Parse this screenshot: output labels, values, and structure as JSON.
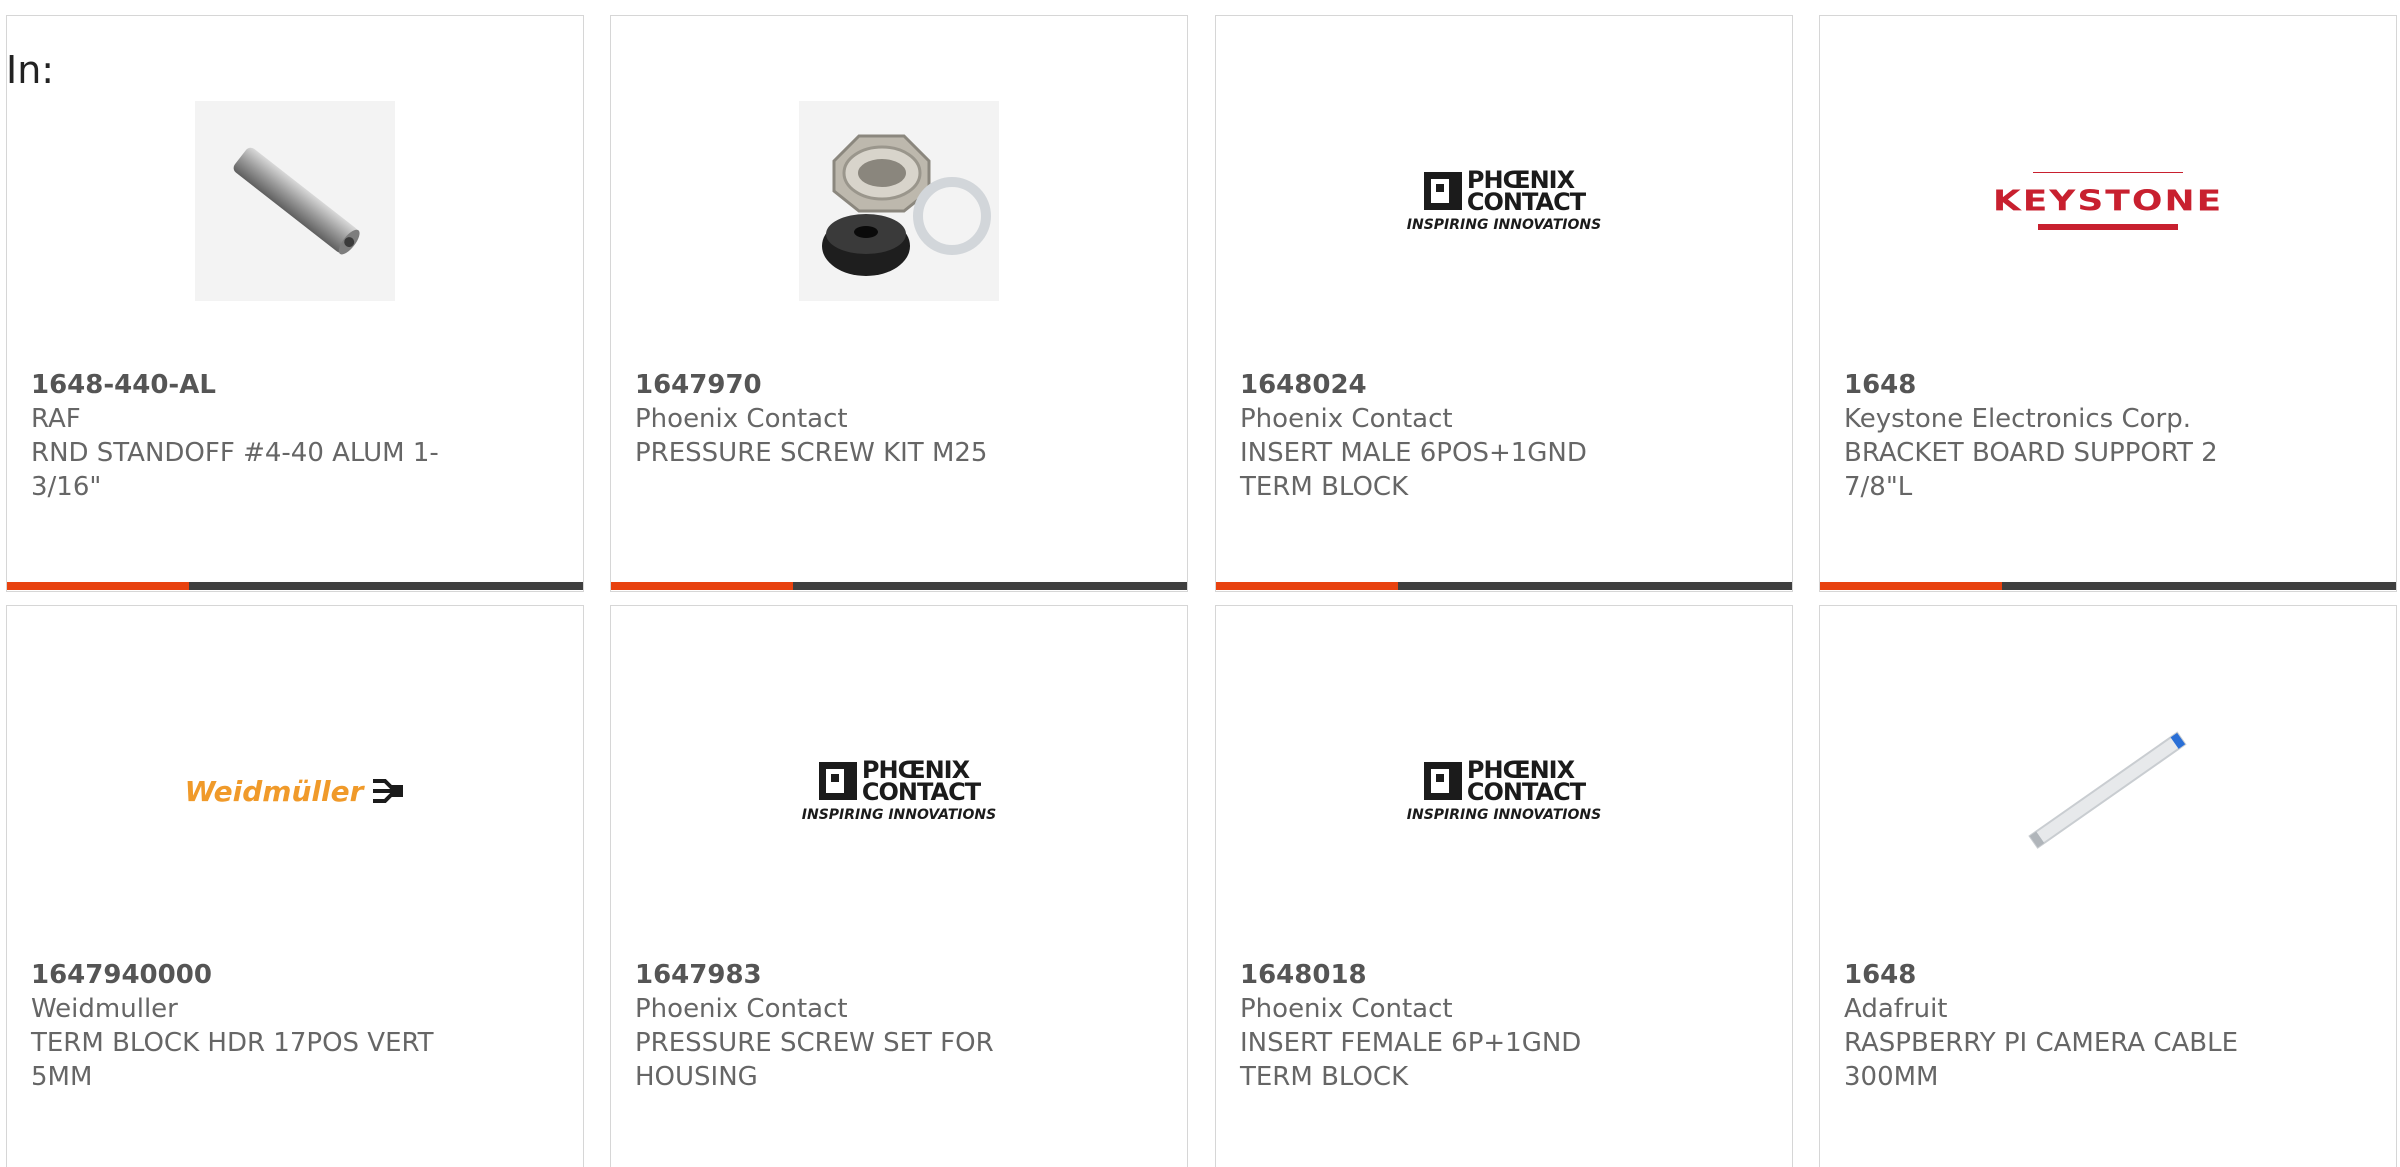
{
  "header": {
    "in_label": "In:"
  },
  "cards": [
    {
      "part_number": "1648-440-AL",
      "manufacturer": "RAF",
      "description": "RND STANDOFF #4-40 ALUM 1-3/16\"",
      "image": "standoff-photo"
    },
    {
      "part_number": "1647970",
      "manufacturer": "Phoenix Contact",
      "description": "PRESSURE SCREW KIT M25",
      "image": "pressure-screw-kit-photo"
    },
    {
      "part_number": "1648024",
      "manufacturer": "Phoenix Contact",
      "description": "INSERT MALE 6POS+1GND TERM BLOCK",
      "image": "phoenix-contact-logo"
    },
    {
      "part_number": "1648",
      "manufacturer": "Keystone Electronics Corp.",
      "description": "BRACKET BOARD SUPPORT 2 7/8\"L",
      "image": "keystone-logo"
    },
    {
      "part_number": "1647940000",
      "manufacturer": "Weidmuller",
      "description": "TERM BLOCK HDR 17POS VERT 5MM",
      "image": "weidmuller-logo"
    },
    {
      "part_number": "1647983",
      "manufacturer": "Phoenix Contact",
      "description": "PRESSURE SCREW SET FOR HOUSING",
      "image": "phoenix-contact-logo"
    },
    {
      "part_number": "1648018",
      "manufacturer": "Phoenix Contact",
      "description": "INSERT FEMALE 6P+1GND TERM BLOCK",
      "image": "phoenix-contact-logo"
    },
    {
      "part_number": "1648",
      "manufacturer": "Adafruit",
      "description": "RASPBERRY PI CAMERA CABLE 300MM",
      "image": "ribbon-cable-photo"
    }
  ],
  "logos": {
    "phoenix_line1": "PHŒNIX",
    "phoenix_line2": "CONTACT",
    "phoenix_tagline": "INSPIRING INNOVATIONS",
    "keystone_name": "KEYSTONE",
    "weidmuller_name": "Weidmüller"
  },
  "colors": {
    "accent": "#e8420f",
    "bar_dark": "#3f3f3f",
    "card_border": "#d6d6d6",
    "text": "#666666",
    "keystone_red": "#c8202f",
    "weidmuller_orange": "#f09a2a"
  }
}
